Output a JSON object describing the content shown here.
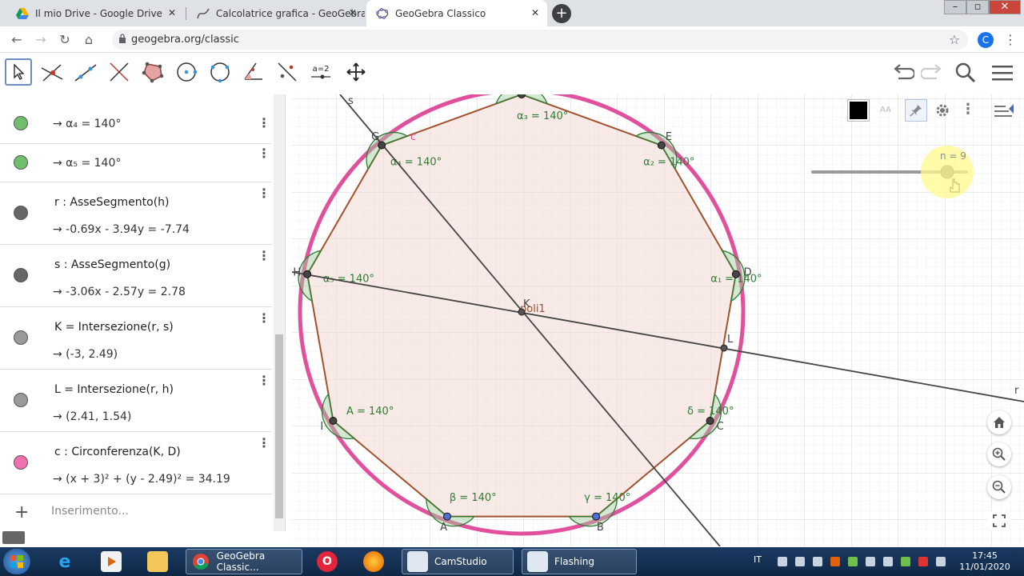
{
  "browser": {
    "tabs": [
      {
        "label": "Il mio Drive - Google Drive",
        "icon": "google-drive-icon"
      },
      {
        "label": "Calcolatrice grafica - GeoGebra",
        "icon": "geogebra-graphing-icon"
      },
      {
        "label": "GeoGebra Classico",
        "icon": "geogebra-icon",
        "active": true
      }
    ],
    "url": "geogebra.org/classic",
    "profile_initial": "C"
  },
  "toolbar": {
    "tools": [
      "move-tool",
      "point-tool",
      "line-tool",
      "perpendicular-tool",
      "polygon-tool",
      "circle-tool",
      "circle-3points-tool",
      "angle-tool",
      "reflect-tool",
      "slider-tool",
      "move-graphics-tool"
    ],
    "slider_tool_label": "a=2"
  },
  "algebra": {
    "rows": [
      {
        "def": "",
        "value": "→  α₄ = 140°",
        "dot_color": "#6fbf6f"
      },
      {
        "def": "",
        "value": "→  α₅ = 140°",
        "dot_color": "#6fbf6f"
      },
      {
        "def": "r : AsseSegmento(h)",
        "value": "→  -0.69x - 3.94y = -7.74",
        "dot_color": "#666666"
      },
      {
        "def": "s : AsseSegmento(g)",
        "value": "→  -3.06x - 2.57y = 2.78",
        "dot_color": "#666666"
      },
      {
        "def": "K = Intersezione(r, s)",
        "value": "→  (-3, 2.49)",
        "dot_color": "#9a9a9a"
      },
      {
        "def": "L = Intersezione(r, h)",
        "value": "→  (2.41, 1.54)",
        "dot_color": "#9a9a9a"
      },
      {
        "def": "c : Circonferenza(K, D)",
        "value": "→  (x + 3)² + (y - 2.49)² = 34.19",
        "dot_color": "#f070b0"
      }
    ],
    "input_placeholder": "Inserimento..."
  },
  "graphics": {
    "slider_label": "n = 9",
    "polygon_label": "poli1",
    "angle_value": "140°",
    "vertices": [
      {
        "name": "A",
        "kind": "free"
      },
      {
        "name": "B",
        "kind": "free"
      },
      {
        "name": "C",
        "kind": "dependent"
      },
      {
        "name": "D",
        "kind": "dependent"
      },
      {
        "name": "E",
        "kind": "dependent"
      },
      {
        "name": "F",
        "kind": "dependent"
      },
      {
        "name": "G",
        "kind": "dependent"
      },
      {
        "name": "H",
        "kind": "dependent"
      },
      {
        "name": "I",
        "kind": "dependent"
      }
    ],
    "angle_labels": [
      "β",
      "γ",
      "δ",
      "α₁",
      "α₂",
      "α₃",
      "α₄",
      "α₅",
      "A"
    ],
    "points": {
      "K": "K",
      "L": "L"
    },
    "line_labels": {
      "s": "s",
      "r": "r",
      "c": "c"
    },
    "colors": {
      "circle": "#e0509c",
      "polygon_edge": "#a0522d",
      "polygon_fill": "#f3d8d3",
      "angle": "#2e7d32",
      "lines": "#444444"
    }
  },
  "taskbar": {
    "apps": [
      {
        "label": "",
        "icon": "windows-start-icon"
      },
      {
        "label": "",
        "icon": "internet-explorer-icon"
      },
      {
        "label": "",
        "icon": "media-player-icon"
      },
      {
        "label": "",
        "icon": "file-explorer-icon"
      },
      {
        "label": "GeoGebra Classic...",
        "icon": "chrome-icon"
      },
      {
        "label": "",
        "icon": "opera-icon"
      },
      {
        "label": "",
        "icon": "firefox-icon"
      },
      {
        "label": "CamStudio",
        "icon": "camstudio-icon"
      },
      {
        "label": "Flashing",
        "icon": "flashing-icon"
      }
    ],
    "language": "IT",
    "time": "17:45",
    "date": "11/01/2020"
  }
}
